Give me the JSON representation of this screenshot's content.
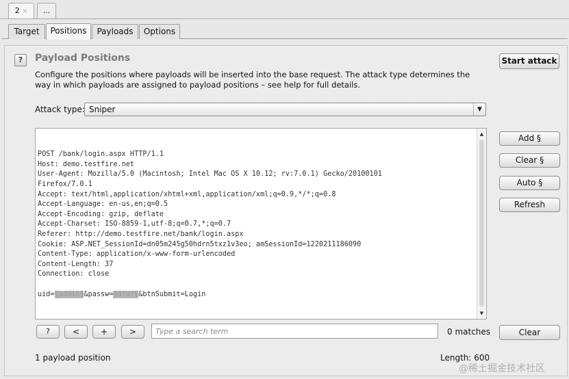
{
  "request_tabs": [
    {
      "label": "2",
      "close": "×"
    },
    {
      "label": "..."
    }
  ],
  "sub_tabs": [
    "Target",
    "Positions",
    "Payloads",
    "Options"
  ],
  "active_sub_tab": "Positions",
  "panel": {
    "help": "?",
    "title": "Payload Positions",
    "description": "Configure the positions where payloads will be inserted into the base request. The attack type determines the way in which payloads are assigned to payload positions – see help for full details.",
    "start_attack": "Start attack",
    "attack_type_label": "Attack type:",
    "attack_type_value": "Sniper"
  },
  "request_lines": [
    "POST /bank/login.aspx HTTP/1.1",
    "Host: demo.testfire.net",
    "User-Agent: Mozilla/5.0 (Macintosh; Intel Mac OS X 10.12; rv:7.0.1) Gecko/20100101",
    "Firefox/7.0.1",
    "Accept: text/html,application/xhtml+xml,application/xml;q=0.9,*/*;q=0.8",
    "Accept-Language: en-us,en;q=0.5",
    "Accept-Encoding: gzip, deflate",
    "Accept-Charset: ISO-8859-1,utf-8;q=0.7,*;q=0.7",
    "Referer: http://demo.testfire.net/bank/login.aspx",
    "Cookie: ASP.NET_SessionId=dn05m245g50hdrn5txz1v3eo; amSessionId=1220211186090",
    "Content-Type: application/x-www-form-urlencoded",
    "Content-Length: 37",
    "Connection: close",
    ""
  ],
  "body_line": {
    "prefix": "uid=",
    "marker1": "§admin§",
    "middle": "&passw=",
    "marker2": "§dfdf§",
    "suffix": "&btnSubmit=Login"
  },
  "side_buttons": [
    "Add §",
    "Clear §",
    "Auto §",
    "Refresh"
  ],
  "toolbar": {
    "help": "?",
    "prev": "<",
    "add": "+",
    "next": ">",
    "search_placeholder": "Type a search term",
    "matches": "0 matches",
    "clear": "Clear"
  },
  "status": {
    "payload_positions": "1 payload position",
    "length": "Length: 600"
  },
  "watermark": "@稀土掘金技术社区"
}
